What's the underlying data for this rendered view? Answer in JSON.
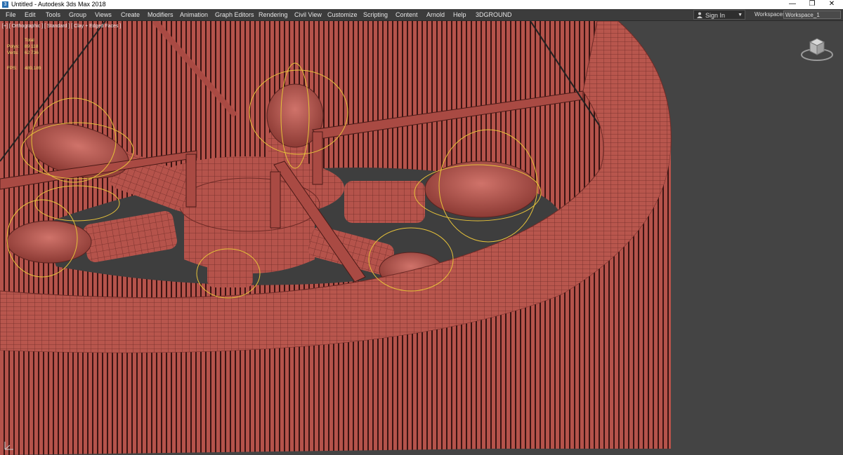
{
  "window": {
    "title": "Untitled - Autodesk 3ds Max 2018",
    "minimize": "—",
    "maximize": "❐",
    "close": "✕"
  },
  "menu": [
    "File",
    "Edit",
    "Tools",
    "Group",
    "Views",
    "Create",
    "Modifiers",
    "Animation",
    "Graph Editors",
    "Rendering",
    "Civil View",
    "Customize",
    "Scripting",
    "Content",
    "Arnold",
    "Help",
    "3DGROUND"
  ],
  "signin": {
    "label": "Sign In"
  },
  "workspaces": {
    "label": "Workspaces:",
    "value": "Workspace_1"
  },
  "viewport": {
    "label": "[+] [ Orthographic ] [ Standard ] [ Clay + Edged Faces ]",
    "stats": {
      "header": "Total",
      "polys_label": "Polys:",
      "polys_value": "89 118",
      "verts_label": "Verts:",
      "verts_value": "62 736",
      "fps_label": "FPS:",
      "fps_value": "489,189"
    }
  },
  "colors": {
    "clay": "#b5534b",
    "clay_dark": "#7c3431",
    "wire": "#3a1412",
    "light_gizmo": "#e6c23a",
    "viewport_bg": "#444444"
  },
  "icons": [
    "app-icon",
    "user-icon",
    "viewcube-icon",
    "axis-tripod-icon"
  ]
}
